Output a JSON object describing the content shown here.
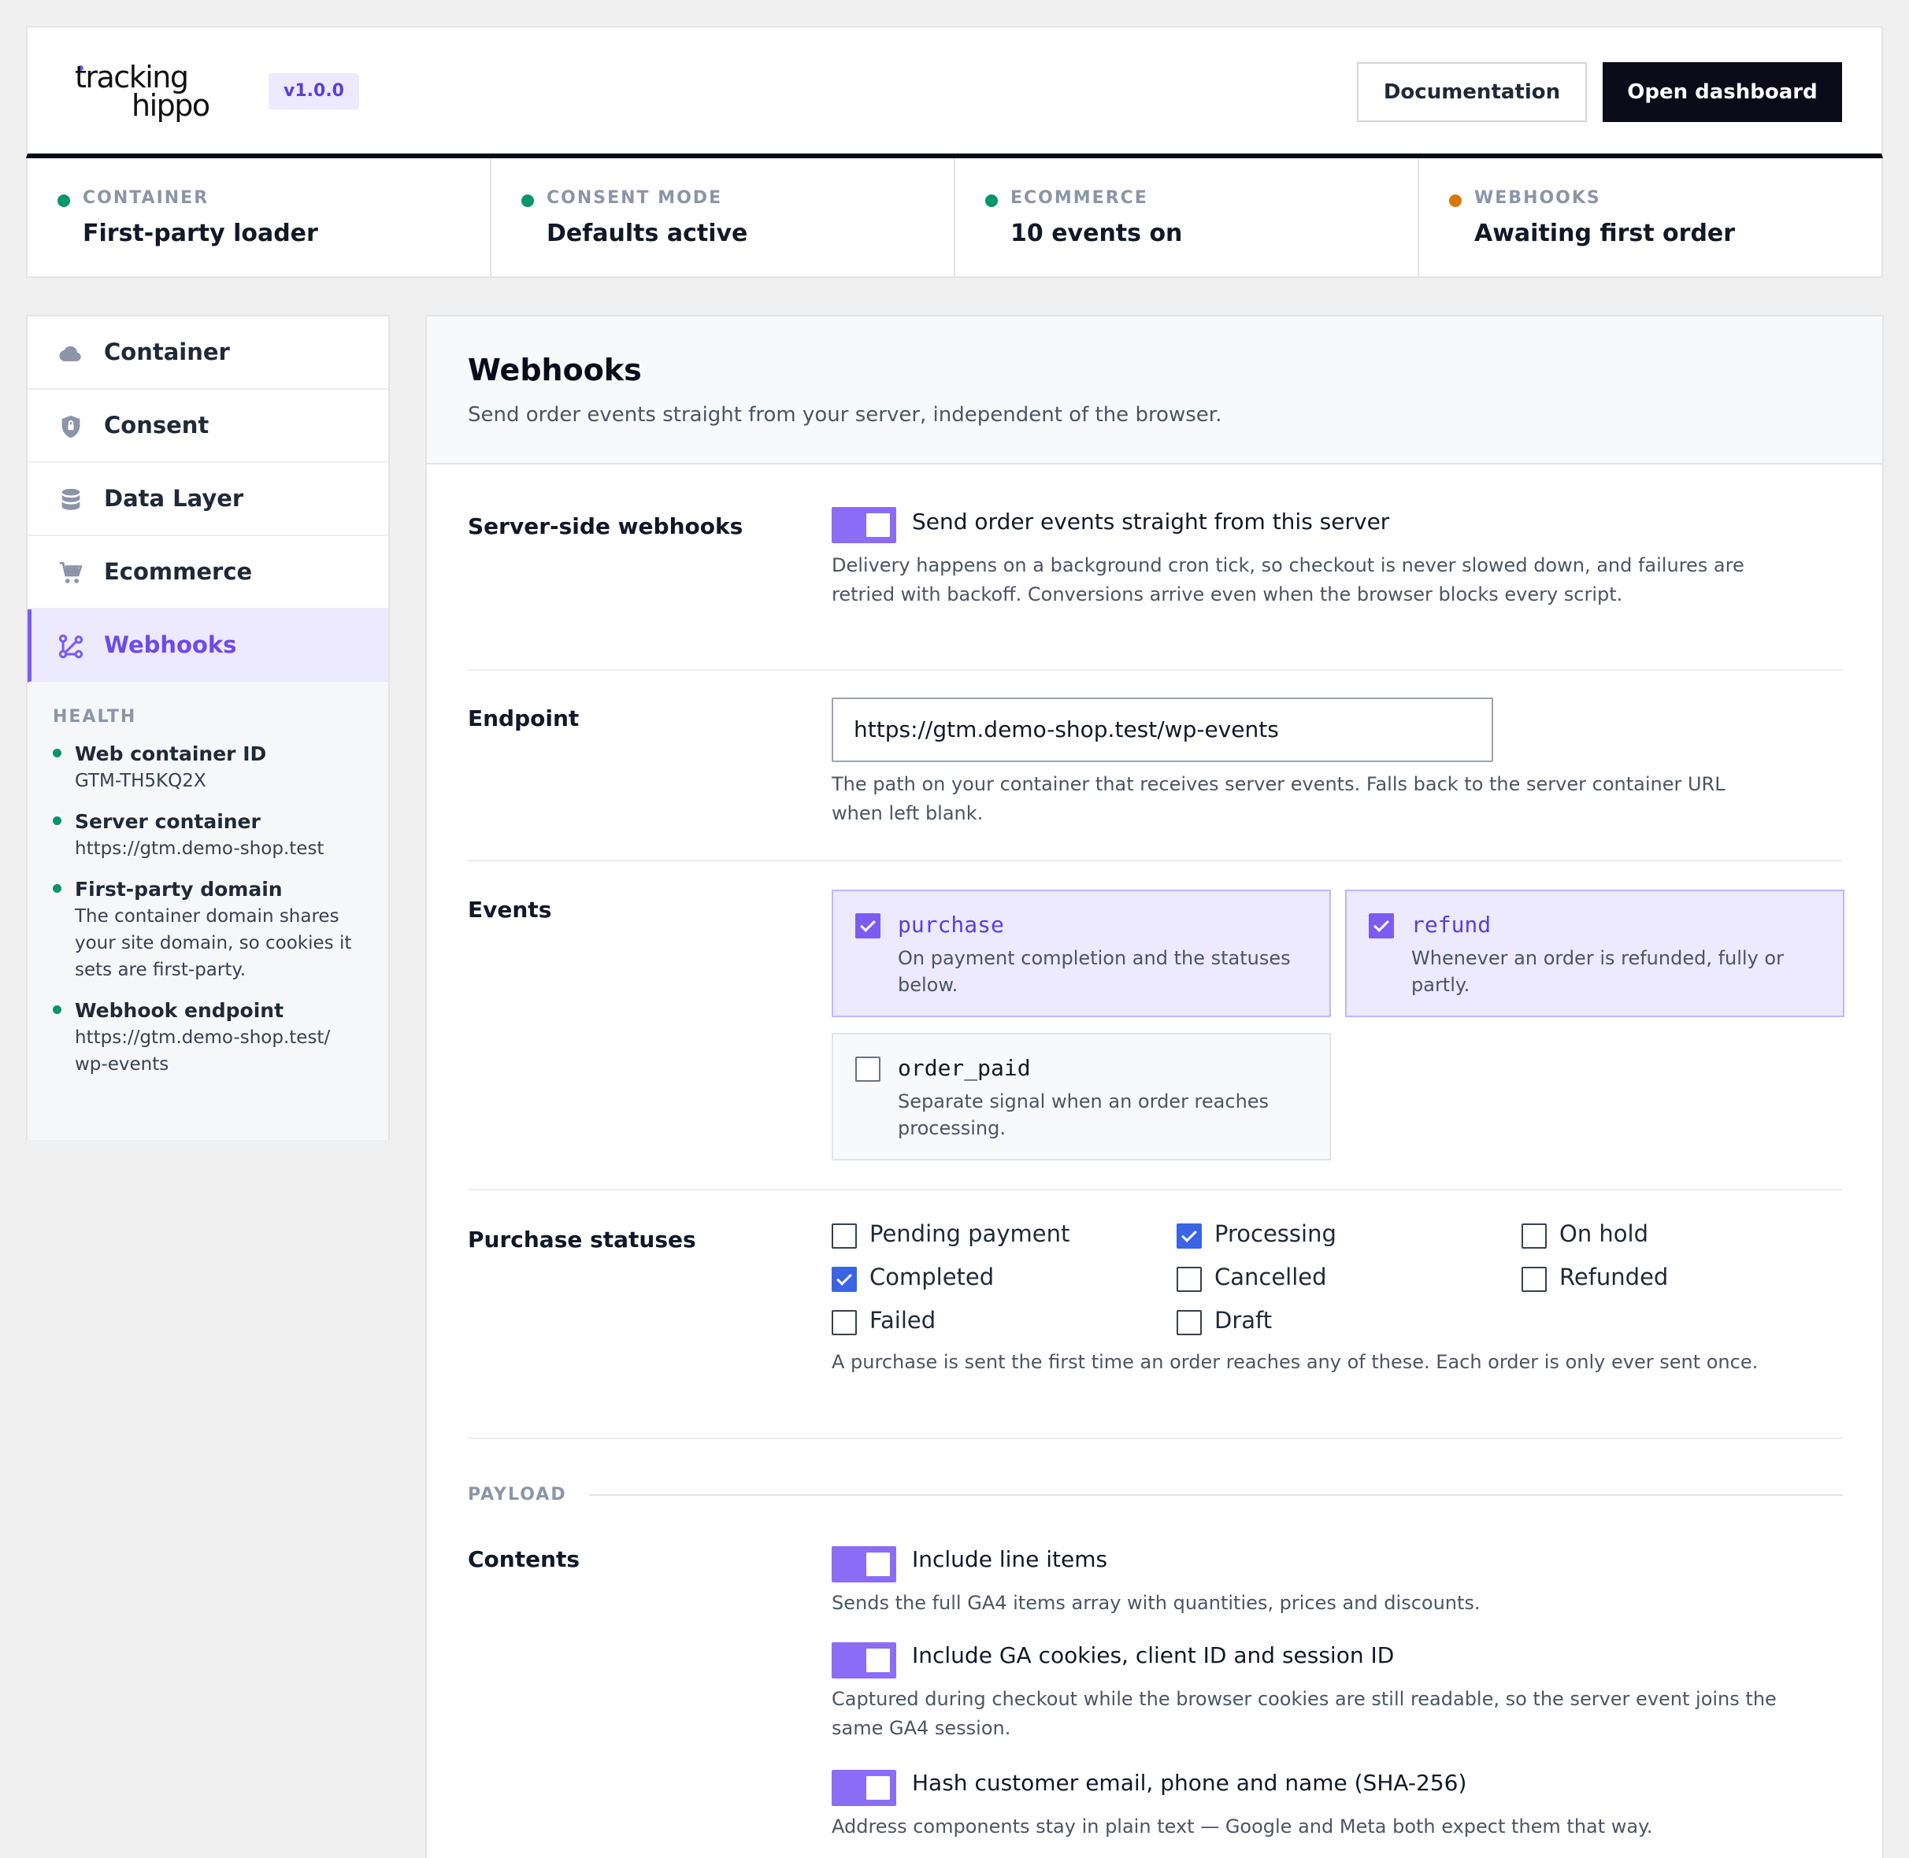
{
  "app": {
    "logo_top": "tracking",
    "logo_bottom": "hippo",
    "version": "v1.0.0",
    "documentation_label": "Documentation",
    "dashboard_label": "Open dashboard"
  },
  "status": [
    {
      "label": "CONTAINER",
      "value": "First-party loader",
      "color": "#059669"
    },
    {
      "label": "CONSENT MODE",
      "value": "Defaults active",
      "color": "#059669"
    },
    {
      "label": "ECOMMERCE",
      "value": "10 events on",
      "color": "#059669"
    },
    {
      "label": "WEBHOOKS",
      "value": "Awaiting first order",
      "color": "#d97706"
    }
  ],
  "sidebar": {
    "items": [
      {
        "label": "Container",
        "icon": "cloud-icon"
      },
      {
        "label": "Consent",
        "icon": "shield-icon"
      },
      {
        "label": "Data Layer",
        "icon": "database-icon"
      },
      {
        "label": "Ecommerce",
        "icon": "cart-icon"
      },
      {
        "label": "Webhooks",
        "icon": "webhook-icon",
        "active": true
      }
    ],
    "health": {
      "title": "HEALTH",
      "items": [
        {
          "name": "Web container ID",
          "value": "GTM-TH5KQ2X"
        },
        {
          "name": "Server container",
          "value": "https://gtm.demo-shop.test"
        },
        {
          "name": "First-party domain",
          "value": "The container domain shares your site domain, so cookies it sets are first-party."
        },
        {
          "name": "Webhook endpoint",
          "value": "https://gtm.demo-shop.test/wp-events"
        }
      ]
    }
  },
  "main": {
    "title": "Webhooks",
    "subtitle": "Send order events straight from your server, independent of the browser.",
    "server_side": {
      "label": "Server-side webhooks",
      "toggle_label": "Send order events straight from this server",
      "enabled": true,
      "help": "Delivery happens on a background cron tick, so checkout is never slowed down, and failures are retried with backoff. Conversions arrive even when the browser blocks every script."
    },
    "endpoint": {
      "label": "Endpoint",
      "value": "https://gtm.demo-shop.test/wp-events",
      "help": "The path on your container that receives server events. Falls back to the server container URL when left blank."
    },
    "events": {
      "label": "Events",
      "items": [
        {
          "name": "purchase",
          "desc": "On payment completion and the statuses below.",
          "checked": true
        },
        {
          "name": "refund",
          "desc": "Whenever an order is refunded, fully or partly.",
          "checked": true
        },
        {
          "name": "order_paid",
          "desc": "Separate signal when an order reaches processing.",
          "checked": false
        }
      ]
    },
    "purchase_statuses": {
      "label": "Purchase statuses",
      "items": [
        {
          "label": "Pending payment",
          "checked": false
        },
        {
          "label": "Processing",
          "checked": true
        },
        {
          "label": "On hold",
          "checked": false
        },
        {
          "label": "Completed",
          "checked": true
        },
        {
          "label": "Cancelled",
          "checked": false
        },
        {
          "label": "Refunded",
          "checked": false
        },
        {
          "label": "Failed",
          "checked": false
        },
        {
          "label": "Draft",
          "checked": false
        }
      ],
      "help": "A purchase is sent the first time an order reaches any of these. Each order is only ever sent once."
    },
    "payload": {
      "section_label": "PAYLOAD",
      "contents_label": "Contents",
      "toggles": [
        {
          "label": "Include line items",
          "help": "Sends the full GA4 items array with quantities, prices and discounts.",
          "enabled": true
        },
        {
          "label": "Include GA cookies, client ID and session ID",
          "help": "Captured during checkout while the browser cookies are still readable, so the server event joins the same GA4 session.",
          "enabled": true
        },
        {
          "label": "Hash customer email, phone and name (SHA-256)",
          "help": "Address components stay in plain text — Google and Meta both expect them that way.",
          "enabled": true
        }
      ]
    }
  }
}
